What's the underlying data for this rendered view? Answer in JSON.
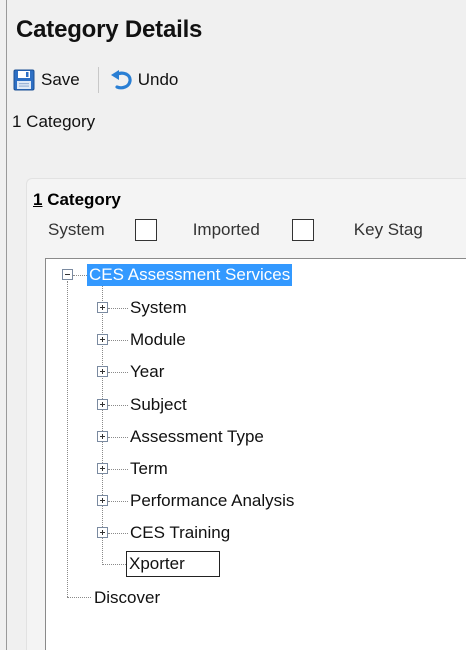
{
  "header": {
    "title": "Category Details"
  },
  "toolbar": {
    "save_label": "Save",
    "undo_label": "Undo",
    "save_icon": "save-disk-icon",
    "undo_icon": "undo-arrow-icon"
  },
  "breadcrumb": {
    "text": "1 Category"
  },
  "section": {
    "number": "1",
    "title": "Category",
    "flags": [
      {
        "label": "System",
        "checked": false
      },
      {
        "label": "Imported",
        "checked": false
      },
      {
        "label": "Key Stag",
        "checked": false
      }
    ]
  },
  "tree": {
    "root": {
      "label": "CES Assessment Services",
      "expanded": true,
      "selected": true
    },
    "children": [
      {
        "label": "System",
        "expandable": true
      },
      {
        "label": "Module",
        "expandable": true
      },
      {
        "label": "Year",
        "expandable": true
      },
      {
        "label": "Subject",
        "expandable": true
      },
      {
        "label": "Assessment Type",
        "expandable": true
      },
      {
        "label": "Term",
        "expandable": true
      },
      {
        "label": "Performance Analysis",
        "expandable": true
      },
      {
        "label": "CES Training",
        "expandable": true
      }
    ],
    "editing_node": {
      "value": "Xporter"
    },
    "sibling_root": {
      "label": "Discover"
    }
  },
  "colors": {
    "selection": "#3399ff",
    "background": "#f0f0f0",
    "tree_background": "#ffffff"
  }
}
